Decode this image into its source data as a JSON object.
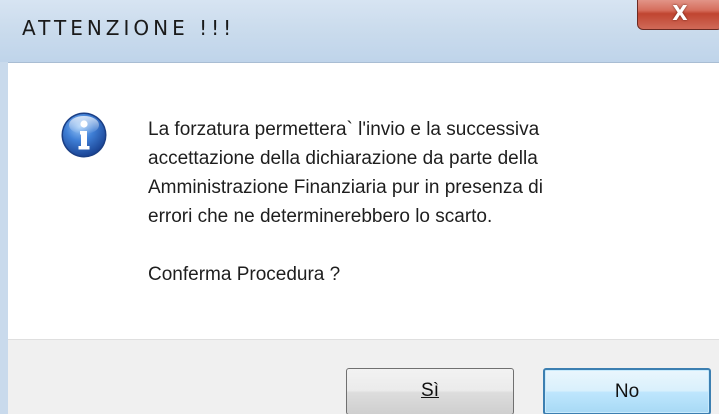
{
  "window": {
    "title": "ATTENZIONE !!!",
    "close_label": "X",
    "close_color": "#c04531"
  },
  "message": {
    "icon": "info-icon",
    "lines": [
      "La forzatura permettera` l'invio e la successiva",
      "accettazione della dichiarazione da parte  della",
      "Amministrazione Finanziaria  pur in  presenza di",
      "errori che ne determinerebbero lo scarto."
    ],
    "confirm": "Conferma Procedura ?"
  },
  "buttons": {
    "yes_label": "Sì",
    "no_label": "No",
    "default_accent": "#3c7fb1"
  }
}
